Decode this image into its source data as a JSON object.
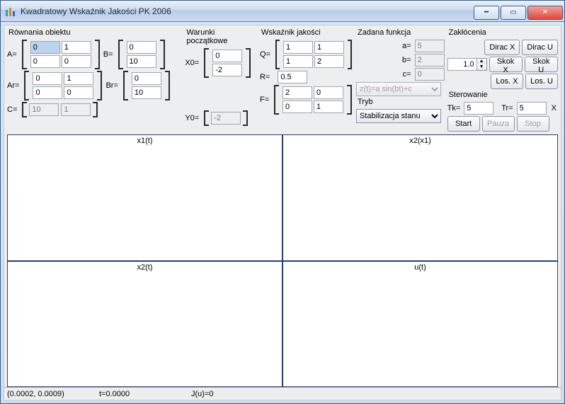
{
  "title": "Kwadratowy Wskaźnik Jakości PK 2006",
  "sections": {
    "rownania": "Równania obiektu",
    "warunki": "Warunki początkowe",
    "wskaznik": "Wskaźnik jakości",
    "zadana": "Zadana funkcja",
    "zaklocenia": "Zakłócenia",
    "sterowanie": "Sterowanie",
    "tryb": "Tryb"
  },
  "labels": {
    "A": "A=",
    "B": "B=",
    "Ar": "Ar=",
    "Br": "Br=",
    "C": "C=",
    "X0": "X0=",
    "Y0": "Y0=",
    "Q": "Q=",
    "R": "R=",
    "F": "F=",
    "a": "a=",
    "b": "b=",
    "c": "c=",
    "Tk": "Tk=",
    "Tr": "Tr=",
    "X": "X"
  },
  "A": [
    [
      "0",
      "1"
    ],
    [
      "0",
      "0"
    ]
  ],
  "B": [
    [
      "0"
    ],
    [
      "10"
    ]
  ],
  "Ar": [
    [
      "0",
      "1"
    ],
    [
      "0",
      "0"
    ]
  ],
  "Br": [
    [
      "0"
    ],
    [
      "10"
    ]
  ],
  "C": [
    "10",
    "1"
  ],
  "X0": [
    [
      "0"
    ],
    [
      "-2"
    ]
  ],
  "Y0": "-2",
  "Q": [
    [
      "1",
      "1"
    ],
    [
      "1",
      "2"
    ]
  ],
  "R": "0.5",
  "F": [
    [
      "2",
      "0"
    ],
    [
      "0",
      "1"
    ]
  ],
  "zadana": {
    "a": "5",
    "b": "2",
    "c": "0",
    "formula": "z(t)=a sin(bt)+c"
  },
  "tryb_selected": "Stabilizacja stanu",
  "zakl": {
    "diracX": "Dirac X",
    "diracU": "Dirac U",
    "skokX": "Skok X",
    "skokU": "Skok U",
    "losX": "Los. X",
    "losU": "Los. U",
    "skokVal": "1.0"
  },
  "ster": {
    "Tk": "5",
    "Tr": "5",
    "start": "Start",
    "pauza": "Pauza",
    "stop": "Stop"
  },
  "plots": {
    "p1": "x1(t)",
    "p2": "x2(x1)",
    "p3": "x2(t)",
    "p4": "u(t)"
  },
  "status": {
    "coords": "(0.0002, 0.0009)",
    "t": "t=0.0000",
    "J": "J(u)=0"
  }
}
